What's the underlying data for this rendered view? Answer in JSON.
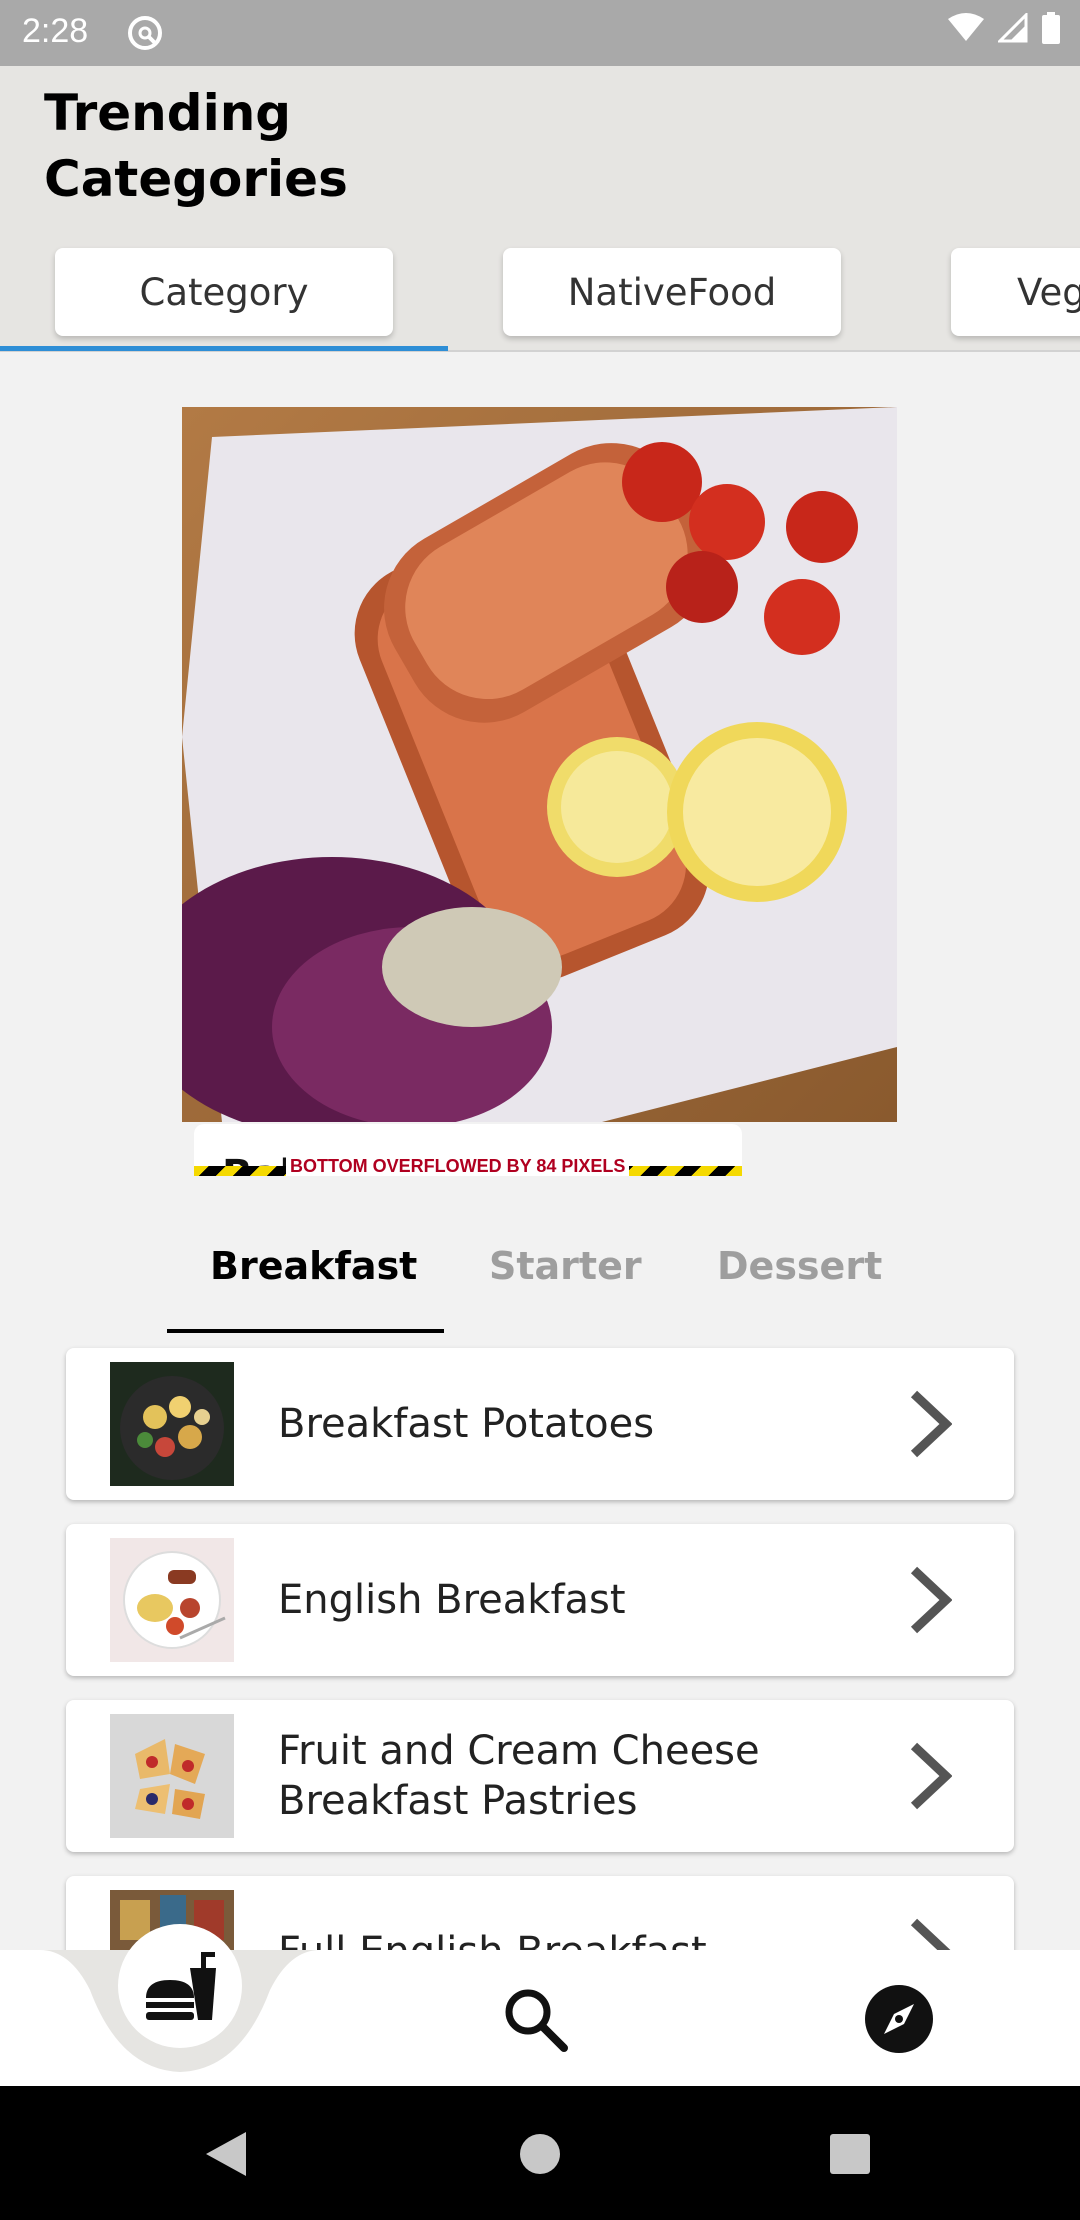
{
  "status_bar": {
    "time": "2:28"
  },
  "header": {
    "title": "Trending Categories",
    "category_tabs": [
      {
        "label": "Category",
        "selected": true
      },
      {
        "label": "NativeFood",
        "selected": false
      },
      {
        "label": "Veg",
        "selected": false
      }
    ]
  },
  "featured": {
    "partial_title": "Bal",
    "overflow_warning": "BOTTOM OVERFLOWED BY 84 PIXELS"
  },
  "meal_tabs": [
    {
      "label": "Breakfast",
      "selected": true
    },
    {
      "label": "Starter",
      "selected": false
    },
    {
      "label": "Dessert",
      "selected": false
    }
  ],
  "recipes": [
    {
      "name": "Breakfast Potatoes"
    },
    {
      "name": "English Breakfast"
    },
    {
      "name": "Fruit and Cream Cheese Breakfast Pastries"
    },
    {
      "name": "Full English Breakfast"
    }
  ],
  "bottom_nav": {
    "items": [
      {
        "icon": "fastfood-icon",
        "active": true
      },
      {
        "icon": "search-icon",
        "active": false
      },
      {
        "icon": "explore-icon",
        "active": false
      }
    ]
  },
  "colors": {
    "tab_indicator": "#2e8ed6",
    "header_background": "#e6e5e2",
    "overflow_warning_text": "#b00020"
  }
}
